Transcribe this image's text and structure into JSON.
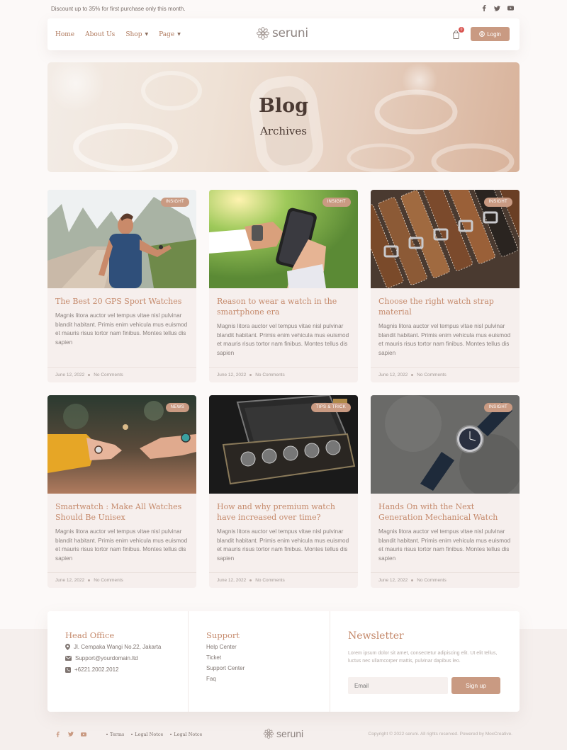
{
  "topbar": {
    "promo": "Discount up to 35% for first purchase only this month.",
    "social_icons": [
      "facebook-icon",
      "twitter-icon",
      "youtube-icon"
    ]
  },
  "nav": {
    "items": [
      {
        "label": "Home",
        "dropdown": false
      },
      {
        "label": "About Us",
        "dropdown": false
      },
      {
        "label": "Shop",
        "dropdown": true
      },
      {
        "label": "Page",
        "dropdown": true
      }
    ],
    "logo": "seruni",
    "cart_count": "0",
    "login_label": "Login"
  },
  "hero": {
    "title": "Blog",
    "subtitle": "Archives"
  },
  "posts": [
    {
      "tag": "INSIGHT",
      "title": "The Best 20 GPS Sport Watches",
      "body": "Magnis litora auctor vel tempus vitae nisl pulvinar blandit habitant. Primis enim vehicula mus euismod et mauris risus tortor nam finibus. Montes tellus dis sapien",
      "date": "June 12, 2022",
      "comments": "No Comments"
    },
    {
      "tag": "INSIGHT",
      "title": "Reason to wear a watch in the smartphone era",
      "body": "Magnis litora auctor vel tempus vitae nisl pulvinar blandit habitant. Primis enim vehicula mus euismod et mauris risus tortor nam finibus. Montes tellus dis sapien",
      "date": "June 12, 2022",
      "comments": "No Comments"
    },
    {
      "tag": "INSIGHT",
      "title": "Choose the right watch strap material",
      "body": "Magnis litora auctor vel tempus vitae nisl pulvinar blandit habitant. Primis enim vehicula mus euismod et mauris risus tortor nam finibus. Montes tellus dis sapien",
      "date": "June 12, 2022",
      "comments": "No Comments"
    },
    {
      "tag": "NEWS",
      "title": "Smartwatch : Make All Watches Should Be Unisex",
      "body": "Magnis litora auctor vel tempus vitae nisl pulvinar blandit habitant. Primis enim vehicula mus euismod et mauris risus tortor nam finibus. Montes tellus dis sapien",
      "date": "June 12, 2022",
      "comments": "No Comments"
    },
    {
      "tag": "TIPS & TRICK",
      "title": "How and why premium watch have increased over time?",
      "body": "Magnis litora auctor vel tempus vitae nisl pulvinar blandit habitant. Primis enim vehicula mus euismod et mauris risus tortor nam finibus. Montes tellus dis sapien",
      "date": "June 12, 2022",
      "comments": "No Comments"
    },
    {
      "tag": "INSIGHT",
      "title": "Hands On with the Next Generation Mechanical Watch",
      "body": "Magnis litora auctor vel tempus vitae nisl pulvinar blandit habitant. Primis enim vehicula mus euismod et mauris risus tortor nam finibus. Montes tellus dis sapien",
      "date": "June 12, 2022",
      "comments": "No Comments"
    }
  ],
  "footer": {
    "head_office": {
      "title": "Head Office",
      "address": "Jl. Cempaka Wangi No.22, Jakarta",
      "email": "Support@yourdomain.ltd",
      "phone": "+6221.2002.2012"
    },
    "support": {
      "title": "Support",
      "links": [
        "Help Center",
        "Ticket",
        "Support Center",
        "Faq"
      ]
    },
    "newsletter": {
      "title": "Newsletter",
      "text": "Lorem ipsum dolor sit amet, consectetur adipiscing elit. Ut elit tellus, luctus nec ullamcorper mattis, pulvinar dapibus leo.",
      "email_placeholder": "Email",
      "button": "Sign up"
    }
  },
  "bottom": {
    "links": [
      "Terms",
      "Legal Notce",
      "Legal Notce"
    ],
    "logo": "seruni",
    "copyright": "Copyright © 2022 seruni. All rights reserved. Powered by MoxCreative."
  },
  "colors": {
    "accent": "#c99a82",
    "title": "#c58a6c",
    "background": "#fcf9f8",
    "card": "#f6efed"
  }
}
